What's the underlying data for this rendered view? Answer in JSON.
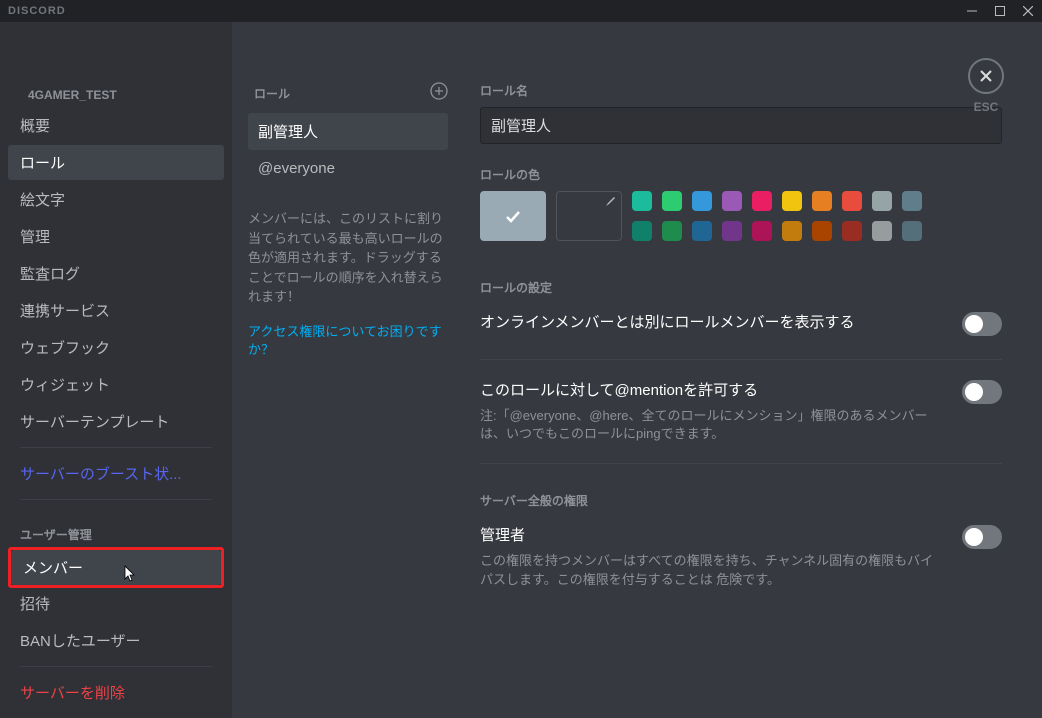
{
  "titlebar": {
    "brand": "DISCORD"
  },
  "sidebar": {
    "server_name": "4GAMER_TEST",
    "items_main": [
      "概要",
      "ロール",
      "絵文字",
      "管理",
      "監査ログ",
      "連携サービス",
      "ウェブフック",
      "ウィジェット",
      "サーバーテンプレート"
    ],
    "boost": "サーバーのブースト状...",
    "user_mgmt_header": "ユーザー管理",
    "items_user": [
      "メンバー",
      "招待",
      "BANしたユーザー"
    ],
    "delete": "サーバーを削除"
  },
  "roles_col": {
    "header": "ロール",
    "items": [
      "副管理人",
      "@everyone"
    ],
    "help": "メンバーには、このリストに割り当てられている最も高いロールの色が適用されます。ドラッグすることでロールの順序を入れ替えられます！",
    "link": "アクセス権限についてお困りですか？"
  },
  "role_form": {
    "name_label": "ロール名",
    "name_value": "副管理人",
    "color_label": "ロールの色",
    "colors_row1": [
      "#1abc9c",
      "#2ecc71",
      "#3498db",
      "#9b59b6",
      "#e91e63",
      "#f1c40f",
      "#e67e22",
      "#e74c3c",
      "#95a5a6",
      "#607d8b"
    ],
    "colors_row2": [
      "#11806a",
      "#1f8b4c",
      "#206694",
      "#71368a",
      "#ad1457",
      "#c27c0e",
      "#a84300",
      "#992d22",
      "#979c9f",
      "#546e7a"
    ],
    "settings_label": "ロールの設定",
    "setting1_title": "オンラインメンバーとは別にロールメンバーを表示する",
    "setting2_title": "このロールに対して@mentionを許可する",
    "setting2_note": "注:「@everyone、@here、全てのロールにメンション」権限のあるメンバーは、いつでもこのロールにpingできます。",
    "perms_label": "サーバー全般の権限",
    "perm1_title": "管理者",
    "perm1_note": "この権限を持つメンバーはすべての権限を持ち、チャンネル固有の権限もバイパスします。この権限を付与することは 危険です。"
  },
  "close": {
    "label": "ESC"
  }
}
